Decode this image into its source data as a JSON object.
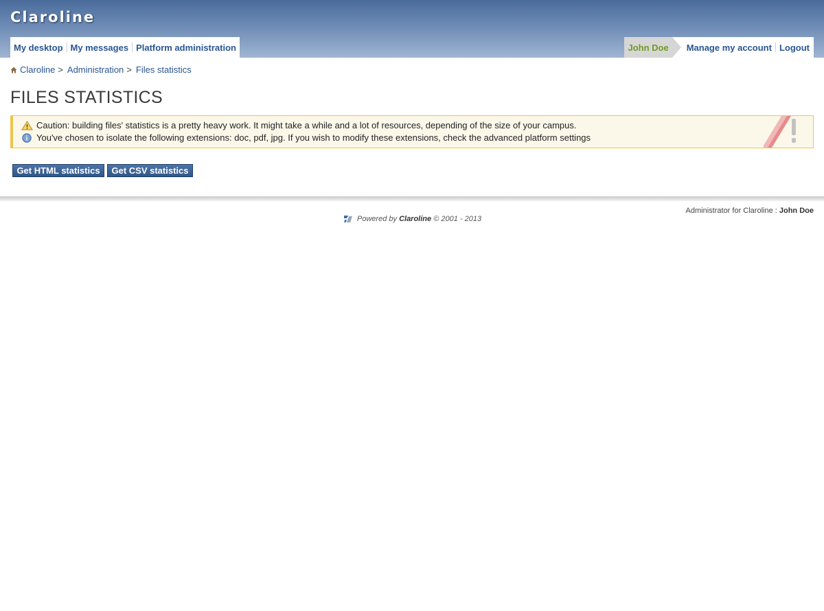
{
  "header": {
    "logo": "Claroline"
  },
  "nav": {
    "left": [
      "My desktop",
      "My messages",
      "Platform administration"
    ],
    "user": "John Doe",
    "manage_account": "Manage my account",
    "logout": "Logout"
  },
  "breadcrumb": {
    "items": [
      "Claroline",
      "Administration",
      "Files statistics"
    ],
    "separator": ">"
  },
  "page": {
    "title": "FILES STATISTICS"
  },
  "messages": {
    "warning": "Caution: building files' statistics is a pretty heavy work. It might take a while and a lot of resources, depending of the size of your campus.",
    "info": "You've chosen to isolate the following extensions: doc, pdf, jpg. If you wish to modify these extensions, check the advanced platform settings"
  },
  "buttons": {
    "html": "Get HTML statistics",
    "csv": "Get CSV statistics"
  },
  "footer": {
    "admin_label": "Administrator for Claroline : ",
    "admin_name": "John Doe",
    "powered_prefix": "Powered by ",
    "powered_brand": "Claroline",
    "powered_suffix": " © 2001 - 2013"
  },
  "colors": {
    "header_top": "#4a6c9b",
    "link": "#2a5591",
    "user_green": "#6f9a23",
    "warning_border": "#f0c44a",
    "button": "#2f5789"
  }
}
